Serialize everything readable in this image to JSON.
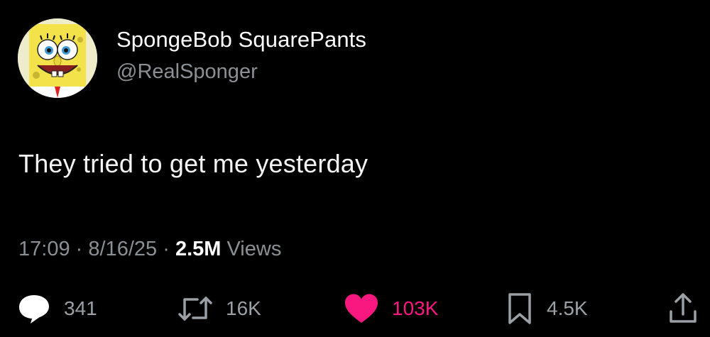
{
  "user": {
    "display_name": "SpongeBob SquarePants",
    "handle": "@RealSponger",
    "avatar_icon": "spongebob-avatar"
  },
  "tweet": {
    "text": "They tried to get me yesterday",
    "time": "17:09",
    "separator": "·",
    "date": "8/16/25",
    "views_count": "2.5M",
    "views_label": "Views"
  },
  "actions": {
    "reply": {
      "icon": "reply-icon",
      "count": "341"
    },
    "repost": {
      "icon": "repost-icon",
      "count": "16K"
    },
    "like": {
      "icon": "heart-icon",
      "count": "103K",
      "color": "#f81880"
    },
    "bookmark": {
      "icon": "bookmark-icon",
      "count": "4.5K"
    },
    "share": {
      "icon": "share-icon"
    }
  },
  "colors": {
    "background": "#000000",
    "text": "#ffffff",
    "muted": "#8b9096",
    "like": "#f81880"
  }
}
